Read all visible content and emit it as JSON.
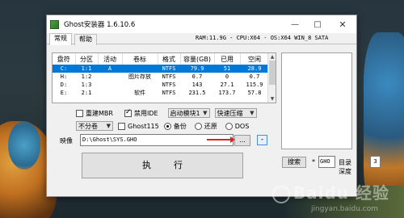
{
  "window": {
    "title": "Ghost安装器 1.6.10.6",
    "minimize_glyph": "—",
    "maximize_glyph": "□",
    "close_glyph": "✕"
  },
  "tabs": [
    {
      "label": "常规",
      "active": true
    },
    {
      "label": "帮助",
      "active": false
    }
  ],
  "sysinfo": "RAM:11.9G - CPU:X64 - OS:X64 WIN_8 SATA",
  "partition_table": {
    "columns": [
      "盘符",
      "分区",
      "活动",
      "卷标",
      "格式",
      "容量(GB)",
      "已用",
      "空闲"
    ],
    "rows": [
      [
        "C:",
        "1:1",
        "A",
        "",
        "NTFS",
        "79.9",
        "51",
        "28.9"
      ],
      [
        "H:",
        "1:2",
        "",
        "图片存放",
        "NTFS",
        "0.7",
        "0",
        "0.7"
      ],
      [
        "D:",
        "1:3",
        "",
        "",
        "NTFS",
        "143",
        "27.1",
        "115.9"
      ],
      [
        "E:",
        "2:1",
        "",
        "软件",
        "NTFS",
        "231.5",
        "173.7",
        "57.8"
      ]
    ],
    "selected_index": 0
  },
  "options": {
    "restart_mbr": {
      "label": "重建MBR",
      "checked": false
    },
    "disable_ide": {
      "label": "禁用IDE",
      "checked": true
    },
    "boot_mode": "启动模块1",
    "compression": "快速压缩",
    "split_volume": "不分卷",
    "ghost115": {
      "label": "Ghost115",
      "checked": false
    },
    "mode_backup": {
      "label": "备份",
      "selected": true
    },
    "mode_restore": {
      "label": "还原",
      "selected": false
    },
    "mode_dos": {
      "label": "DOS",
      "selected": false
    }
  },
  "image": {
    "label": "映像",
    "path": "D:\\Ghost\\SYS.GHO",
    "browse_label": "...",
    "minus_label": "-"
  },
  "execute_label": "执行",
  "search": {
    "button_label": "搜索",
    "star": "*",
    "extension": "GHO",
    "depth_label": "目录深度",
    "depth_value": "3"
  },
  "colors": {
    "selection": "#0078d7",
    "annotation_arrow": "#e02020"
  },
  "watermark": {
    "brand": "Baidu 经验",
    "url": "jingyan.baidu.com"
  }
}
